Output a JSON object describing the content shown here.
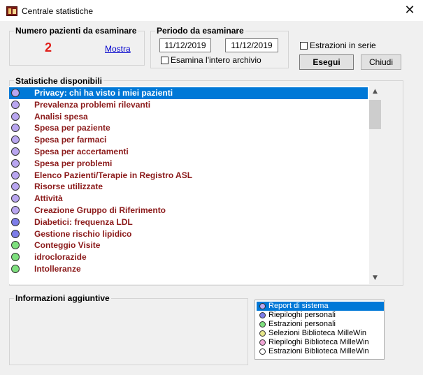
{
  "window": {
    "title": "Centrale statistiche"
  },
  "patients": {
    "group_label": "Numero pazienti da esaminare",
    "count": "2",
    "show_link": "Mostra"
  },
  "period": {
    "group_label": "Periodo da esaminare",
    "date_from": "11/12/2019",
    "date_to": "11/12/2019",
    "whole_archive_label": "Esamina l'intero archivio",
    "whole_archive_checked": false
  },
  "batch": {
    "label": "Estrazioni in serie",
    "checked": false
  },
  "buttons": {
    "run": "Esegui",
    "close": "Chiudi"
  },
  "stats": {
    "group_label": "Statistiche disponibili",
    "selected_index": 0,
    "items": [
      {
        "label": "Privacy: chi ha visto i miei pazienti",
        "color": "#b9a6f0"
      },
      {
        "label": "Prevalenza problemi rilevanti",
        "color": "#b9a6f0"
      },
      {
        "label": "Analisi spesa",
        "color": "#b9a6f0"
      },
      {
        "label": "Spesa per paziente",
        "color": "#b9a6f0"
      },
      {
        "label": "Spesa per farmaci",
        "color": "#b9a6f0"
      },
      {
        "label": "Spesa per accertamenti",
        "color": "#b9a6f0"
      },
      {
        "label": "Spesa per problemi",
        "color": "#b9a6f0"
      },
      {
        "label": "Elenco Pazienti/Terapie in Registro ASL",
        "color": "#b9a6f0"
      },
      {
        "label": "Risorse utilizzate",
        "color": "#b9a6f0"
      },
      {
        "label": "Attività",
        "color": "#b9a6f0"
      },
      {
        "label": "Creazione Gruppo di Riferimento",
        "color": "#b9a6f0"
      },
      {
        "label": "Diabetici: frequenza LDL",
        "color": "#7d7de8"
      },
      {
        "label": "Gestione rischio lipidico",
        "color": "#7d7de8"
      },
      {
        "label": "Conteggio Visite",
        "color": "#7ee07e"
      },
      {
        "label": "idroclorazide",
        "color": "#7ee07e"
      },
      {
        "label": "Intolleranze",
        "color": "#7ee07e"
      }
    ]
  },
  "extra_info": {
    "group_label": "Informazioni aggiuntive"
  },
  "legend": {
    "selected_index": 0,
    "items": [
      {
        "label": "Report di sistema",
        "color": "#b9a6f0"
      },
      {
        "label": "Riepiloghi personali",
        "color": "#7d7de8"
      },
      {
        "label": "Estrazioni personali",
        "color": "#7ee07e"
      },
      {
        "label": "Selezioni Biblioteca MilleWin",
        "color": "#e6e68a"
      },
      {
        "label": "Riepiloghi Biblioteca MilleWin",
        "color": "#f0a6d6"
      },
      {
        "label": "Estrazioni Biblioteca MilleWin",
        "color": "#ffffff"
      }
    ]
  },
  "icons": [
    "app-icon",
    "close-icon",
    "scroll-up-icon",
    "scroll-down-icon",
    "checkbox"
  ]
}
